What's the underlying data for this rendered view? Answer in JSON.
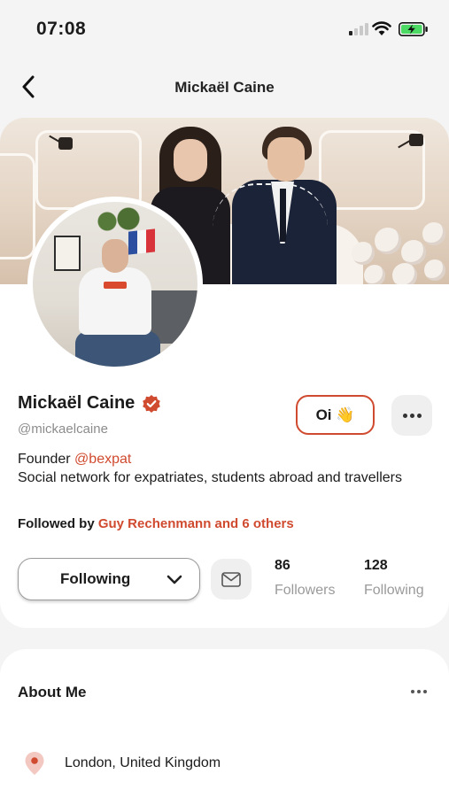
{
  "status_bar": {
    "time": "07:08",
    "icons": [
      "cellular-signal-icon",
      "wifi-icon",
      "battery-charging-icon"
    ]
  },
  "header": {
    "back_icon": "chevron-left-icon",
    "title": "Mickaël Caine"
  },
  "profile": {
    "name": "Mickaël Caine",
    "verified_icon": "verified-badge-icon",
    "handle": "@mickaelcaine",
    "oi_button_label": "Oi 👋",
    "more_icon": "more-horizontal-icon",
    "bio_prefix": "Founder ",
    "bio_mention": "@bexpat",
    "bio_text": "Social network for expatriates, students abroad and travellers",
    "followed_by_prefix": "Followed by ",
    "followed_by_names": "Guy Rechenmann and 6 others",
    "following_button_label": "Following",
    "mail_icon": "mail-icon",
    "stats": {
      "followers_count": "86",
      "followers_label": "Followers",
      "following_count": "128",
      "following_label": "Following"
    }
  },
  "about": {
    "title": "About Me",
    "location_icon": "location-pin-icon",
    "location": "London, United Kingdom"
  },
  "colors": {
    "accent": "#d04a2f",
    "background": "#f4f4f5",
    "card": "#ffffff",
    "muted_text": "#8c8c8c",
    "icon_button_bg": "#efefef",
    "battery_green": "#4cd964"
  }
}
